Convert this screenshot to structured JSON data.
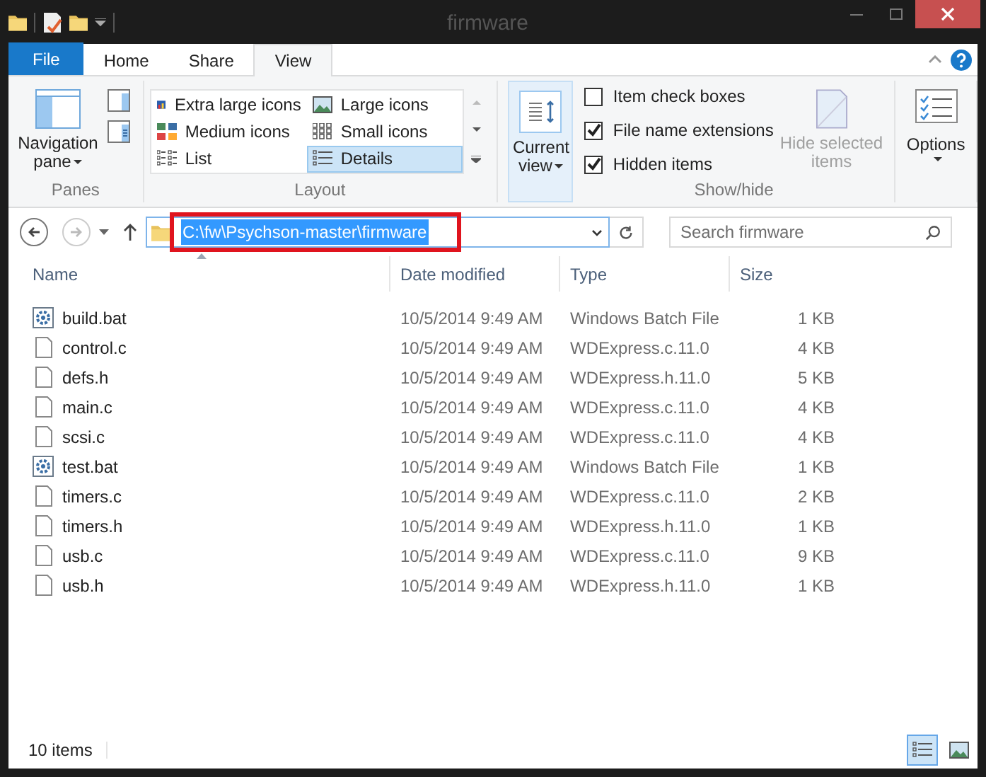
{
  "window": {
    "title": "firmware"
  },
  "ribbon_tabs": [
    {
      "label": "File",
      "kind": "file",
      "selected": false
    },
    {
      "label": "Home",
      "kind": "tab",
      "selected": false
    },
    {
      "label": "Share",
      "kind": "tab",
      "selected": false
    },
    {
      "label": "View",
      "kind": "tab",
      "selected": true
    }
  ],
  "panes": {
    "navigation_pane": "Navigation pane",
    "group_label": "Panes"
  },
  "layout": {
    "items": [
      {
        "label": "Extra large icons",
        "kind": "xl",
        "selected": false
      },
      {
        "label": "Large icons",
        "kind": "large",
        "selected": false
      },
      {
        "label": "Medium icons",
        "kind": "medium",
        "selected": false
      },
      {
        "label": "Small icons",
        "kind": "small",
        "selected": false
      },
      {
        "label": "List",
        "kind": "list",
        "selected": false
      },
      {
        "label": "Details",
        "kind": "details",
        "selected": true
      }
    ],
    "group_label": "Layout"
  },
  "current_view": {
    "label": "Current view",
    "selected": true
  },
  "show_hide": {
    "options": [
      {
        "label": "Item check boxes",
        "checked": false
      },
      {
        "label": "File name extensions",
        "checked": true
      },
      {
        "label": "Hidden items",
        "checked": true
      }
    ],
    "hide_selected": {
      "label": "Hide selected items",
      "disabled": true
    },
    "group_label": "Show/hide"
  },
  "options": {
    "label": "Options"
  },
  "address": {
    "path": "C:\\fw\\Psychson-master\\firmware",
    "placeholder": "Search firmware"
  },
  "columns": [
    {
      "label": "Name",
      "sorted": true
    },
    {
      "label": "Date modified",
      "sorted": false
    },
    {
      "label": "Type",
      "sorted": false
    },
    {
      "label": "Size",
      "sorted": false
    }
  ],
  "rows": [
    {
      "name": "build.bat",
      "kind": "batch",
      "date": "10/5/2014 9:49 AM",
      "type": "Windows Batch File",
      "size": "1 KB"
    },
    {
      "name": "control.c",
      "kind": "file",
      "date": "10/5/2014 9:49 AM",
      "type": "WDExpress.c.11.0",
      "size": "4 KB"
    },
    {
      "name": "defs.h",
      "kind": "file",
      "date": "10/5/2014 9:49 AM",
      "type": "WDExpress.h.11.0",
      "size": "5 KB"
    },
    {
      "name": "main.c",
      "kind": "file",
      "date": "10/5/2014 9:49 AM",
      "type": "WDExpress.c.11.0",
      "size": "4 KB"
    },
    {
      "name": "scsi.c",
      "kind": "file",
      "date": "10/5/2014 9:49 AM",
      "type": "WDExpress.c.11.0",
      "size": "4 KB"
    },
    {
      "name": "test.bat",
      "kind": "batch",
      "date": "10/5/2014 9:49 AM",
      "type": "Windows Batch File",
      "size": "1 KB"
    },
    {
      "name": "timers.c",
      "kind": "file",
      "date": "10/5/2014 9:49 AM",
      "type": "WDExpress.c.11.0",
      "size": "2 KB"
    },
    {
      "name": "timers.h",
      "kind": "file",
      "date": "10/5/2014 9:49 AM",
      "type": "WDExpress.h.11.0",
      "size": "1 KB"
    },
    {
      "name": "usb.c",
      "kind": "file",
      "date": "10/5/2014 9:49 AM",
      "type": "WDExpress.c.11.0",
      "size": "9 KB"
    },
    {
      "name": "usb.h",
      "kind": "file",
      "date": "10/5/2014 9:49 AM",
      "type": "WDExpress.h.11.0",
      "size": "1 KB"
    }
  ],
  "status": {
    "count": "10 items",
    "views": [
      {
        "kind": "details",
        "selected": true
      },
      {
        "kind": "large",
        "selected": false
      }
    ]
  }
}
